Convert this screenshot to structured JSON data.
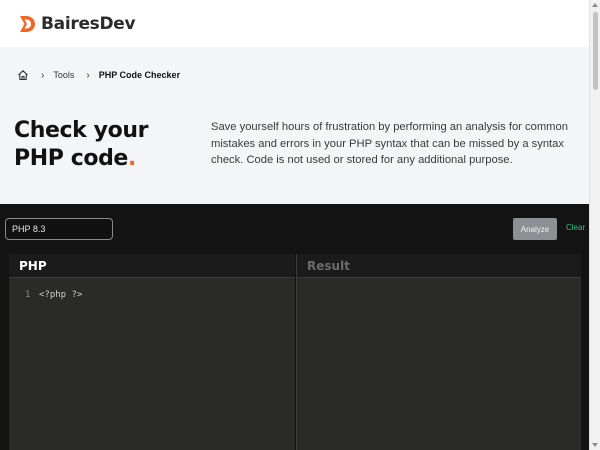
{
  "brand": {
    "name": "BairesDev",
    "accent_color": "#f26522",
    "icon": "bairesdev-logo-icon"
  },
  "breadcrumb": {
    "home_icon": "home-icon",
    "separator": "›",
    "items": [
      "Tools",
      "PHP Code Checker"
    ]
  },
  "hero": {
    "title_line1": "Check your",
    "title_line2": "PHP code",
    "title_dot": ".",
    "description": "Save yourself hours of frustration by performing an analysis for common mistakes and errors in your PHP syntax that can be missed by a syntax check. Code is not used or stored for any additional purpose."
  },
  "toolbar": {
    "version_value": "PHP 8.3",
    "analyze_label": "Analyze",
    "clear_label": "Clear",
    "clear_color": "#2ec27e"
  },
  "editor": {
    "title": "PHP",
    "lines": [
      {
        "number": "1",
        "text": "<?php ?>"
      }
    ]
  },
  "result": {
    "title": "Result"
  }
}
